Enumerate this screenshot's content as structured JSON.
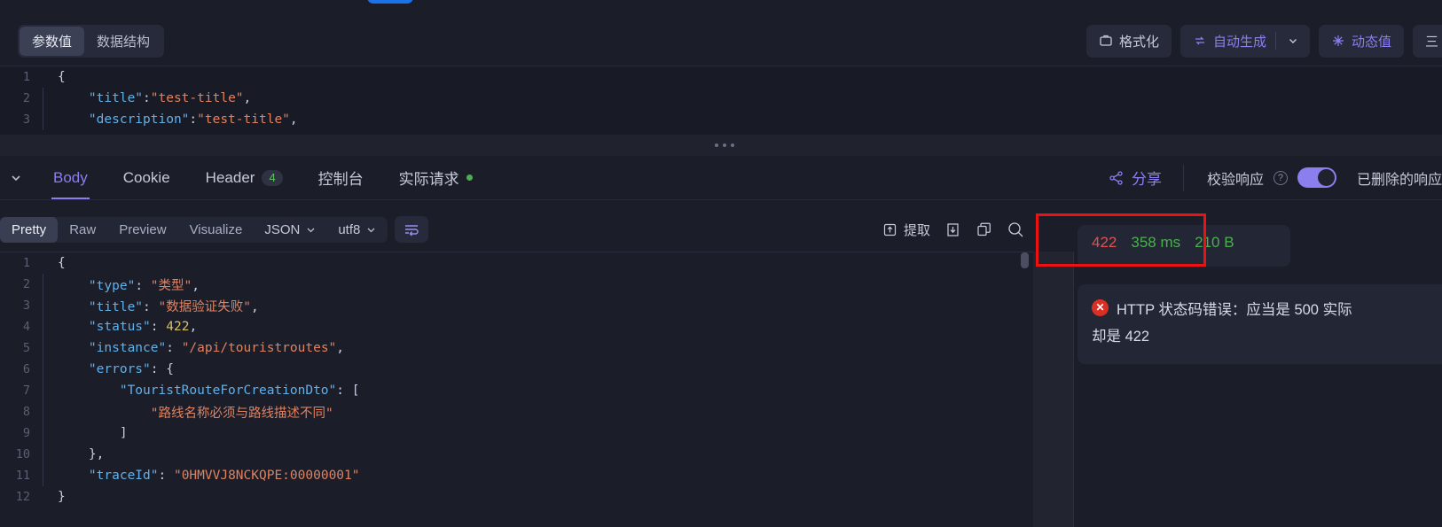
{
  "request_toolbar": {
    "segments": [
      {
        "label": "参数值",
        "active": true
      },
      {
        "label": "数据结构",
        "active": false
      }
    ],
    "format_label": "格式化",
    "autogen_label": "自动生成",
    "dynamic_label": "动态值",
    "clipped_label": "三"
  },
  "request_code": {
    "lines": [
      {
        "num": "1",
        "guide": false,
        "tokens": [
          {
            "t": "{",
            "c": "p"
          }
        ]
      },
      {
        "num": "2",
        "guide": true,
        "tokens": [
          {
            "t": "    \"title\"",
            "c": "k"
          },
          {
            "t": ":",
            "c": "p"
          },
          {
            "t": "\"test-title\"",
            "c": "s"
          },
          {
            "t": ",",
            "c": "p"
          }
        ]
      },
      {
        "num": "3",
        "guide": true,
        "tokens": [
          {
            "t": "    \"description\"",
            "c": "k"
          },
          {
            "t": ":",
            "c": "p"
          },
          {
            "t": "\"test-title\"",
            "c": "s"
          },
          {
            "t": ",",
            "c": "p"
          }
        ]
      }
    ]
  },
  "response_tabs": {
    "items": [
      {
        "label": "Body",
        "active": true,
        "badge": null,
        "dot": false
      },
      {
        "label": "Cookie",
        "active": false,
        "badge": null,
        "dot": false
      },
      {
        "label": "Header",
        "active": false,
        "badge": "4",
        "dot": false
      },
      {
        "label": "控制台",
        "active": false,
        "badge": null,
        "dot": false
      },
      {
        "label": "实际请求",
        "active": false,
        "badge": null,
        "dot": true
      }
    ],
    "share_label": "分享",
    "validate_label": "校验响应",
    "validate_toggle_on": true,
    "deleted_label": "已删除的响应"
  },
  "format_bar": {
    "views": [
      {
        "label": "Pretty",
        "active": true
      },
      {
        "label": "Raw",
        "active": false
      },
      {
        "label": "Preview",
        "active": false
      },
      {
        "label": "Visualize",
        "active": false
      }
    ],
    "language": "JSON",
    "encoding": "utf8",
    "extract_label": "提取"
  },
  "response_code": {
    "lines": [
      {
        "num": "1",
        "guide": false,
        "tokens": [
          {
            "t": "{",
            "c": "p"
          }
        ]
      },
      {
        "num": "2",
        "guide": true,
        "tokens": [
          {
            "t": "    \"type\"",
            "c": "k"
          },
          {
            "t": ": ",
            "c": "p"
          },
          {
            "t": "\"类型\"",
            "c": "s"
          },
          {
            "t": ",",
            "c": "p"
          }
        ]
      },
      {
        "num": "3",
        "guide": true,
        "tokens": [
          {
            "t": "    \"title\"",
            "c": "k"
          },
          {
            "t": ": ",
            "c": "p"
          },
          {
            "t": "\"数据验证失败\"",
            "c": "s"
          },
          {
            "t": ",",
            "c": "p"
          }
        ]
      },
      {
        "num": "4",
        "guide": true,
        "tokens": [
          {
            "t": "    \"status\"",
            "c": "k"
          },
          {
            "t": ": ",
            "c": "p"
          },
          {
            "t": "422",
            "c": "n"
          },
          {
            "t": ",",
            "c": "p"
          }
        ]
      },
      {
        "num": "5",
        "guide": true,
        "tokens": [
          {
            "t": "    \"instance\"",
            "c": "k"
          },
          {
            "t": ": ",
            "c": "p"
          },
          {
            "t": "\"/api/touristroutes\"",
            "c": "s"
          },
          {
            "t": ",",
            "c": "p"
          }
        ]
      },
      {
        "num": "6",
        "guide": true,
        "tokens": [
          {
            "t": "    \"errors\"",
            "c": "k"
          },
          {
            "t": ": {",
            "c": "p"
          }
        ]
      },
      {
        "num": "7",
        "guide": true,
        "tokens": [
          {
            "t": "        \"TouristRouteForCreationDto\"",
            "c": "k"
          },
          {
            "t": ": [",
            "c": "p"
          }
        ]
      },
      {
        "num": "8",
        "guide": true,
        "tokens": [
          {
            "t": "            \"路线名称必须与路线描述不同\"",
            "c": "s"
          }
        ]
      },
      {
        "num": "9",
        "guide": true,
        "tokens": [
          {
            "t": "        ]",
            "c": "p"
          }
        ]
      },
      {
        "num": "10",
        "guide": true,
        "tokens": [
          {
            "t": "    },",
            "c": "p"
          }
        ]
      },
      {
        "num": "11",
        "guide": true,
        "tokens": [
          {
            "t": "    \"traceId\"",
            "c": "k"
          },
          {
            "t": ": ",
            "c": "p"
          },
          {
            "t": "\"0HMVVJ8NCKQPE:00000001\"",
            "c": "s"
          }
        ]
      },
      {
        "num": "12",
        "guide": false,
        "tokens": [
          {
            "t": "}",
            "c": "p"
          }
        ]
      }
    ]
  },
  "status": {
    "code": "422",
    "time": "358 ms",
    "size": "210 B",
    "error_line1": "HTTP 状态码错误：应当是 500 实际",
    "error_line2": "却是 422"
  },
  "colors": {
    "accent": "#8b7ff0",
    "error": "#e05252",
    "success": "#4caf50",
    "annotation": "#ee1111"
  }
}
